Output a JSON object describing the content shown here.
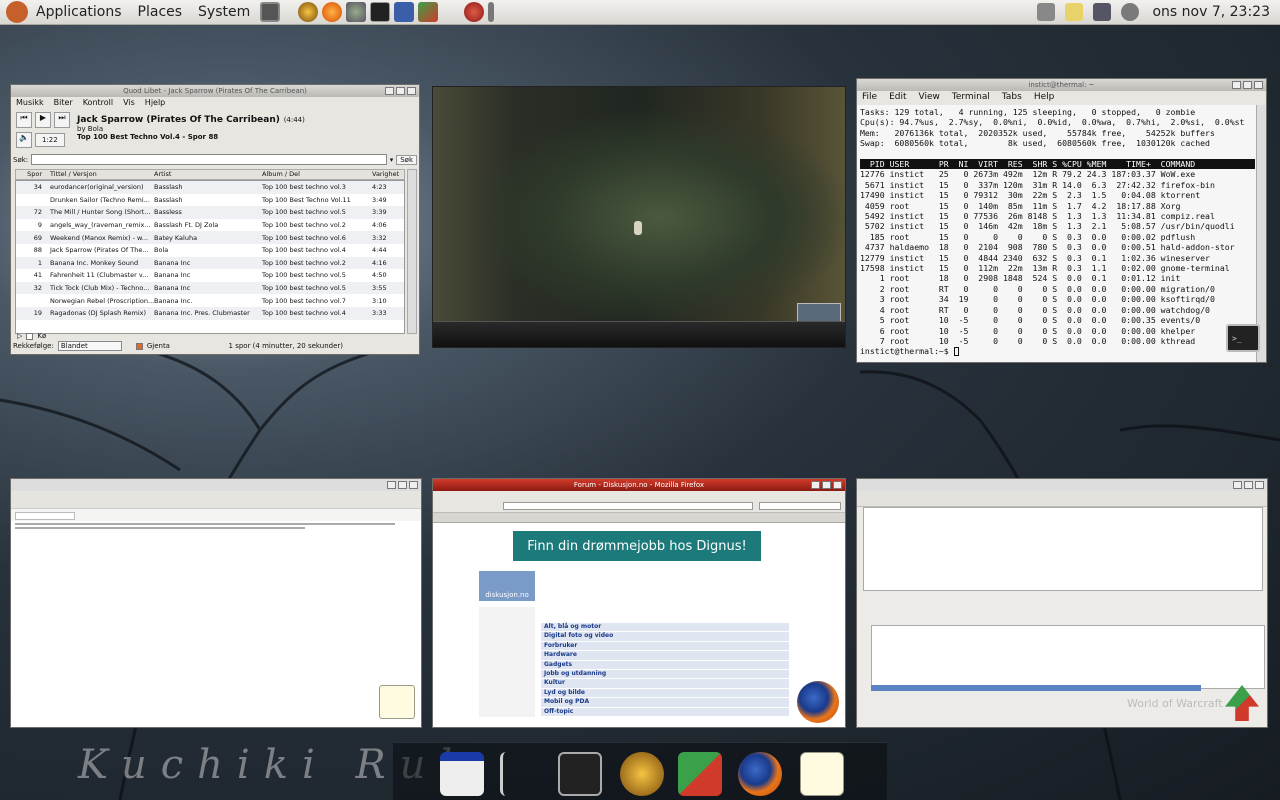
{
  "panel": {
    "menus": [
      "Applications",
      "Places",
      "System"
    ],
    "clock": "ons nov  7, 23:23"
  },
  "quodlibet": {
    "title": "Quod Libet - Jack Sparrow (Pirates Of The Carribean)",
    "menu": [
      "Musikk",
      "Biter",
      "Kontroll",
      "Vis",
      "Hjelp"
    ],
    "track_title": "Jack Sparrow (Pirates Of The Carribean)",
    "duration": "(4:44)",
    "by_line": "by Bola",
    "album_line": "Top 100 Best Techno Vol.4 - Spor 88",
    "position": "1:22",
    "search_label": "Søk:",
    "search_button": "Søk",
    "columns": [
      "Spor",
      "Tittel / Versjon",
      "Artist",
      "Album / Del",
      "Varighet"
    ],
    "rows": [
      [
        "34",
        "eurodancer(original_version)",
        "Basslash",
        "Top 100 best techno vol.3",
        "4:23"
      ],
      [
        "",
        "Drunken Sailor (Techno Remi...",
        "Basslash",
        "Top 100 Best Techno Vol.11",
        "3:49"
      ],
      [
        "72",
        "The Mill / Hunter Song (Short...",
        "Bassless",
        "Top 100 best techno vol.5",
        "3:39"
      ],
      [
        "9",
        "angels_way_(raveman_remix...",
        "Basslash Ft. DJ Zola",
        "Top 100 best techno vol.2",
        "4:06"
      ],
      [
        "69",
        "Weekend (Manox Remix) - w...",
        "Batey Kaluha",
        "Top 100 best techno vol.6",
        "3:32"
      ],
      [
        "88",
        "Jack Sparrow (Pirates Of The...",
        "Bola",
        "Top 100 best techno vol.4",
        "4:44"
      ],
      [
        "1",
        "Banana Inc. Monkey Sound",
        "Banana Inc",
        "Top 100 best techno vol.2",
        "4:16"
      ],
      [
        "41",
        "Fahrenheit 11 (Clubmaster v...",
        "Banana Inc",
        "Top 100 best techno vol.5",
        "4:50"
      ],
      [
        "32",
        "Tick Tock (Club Mix) - Techno...",
        "Banana Inc",
        "Top 100 best techno vol.5",
        "3:55"
      ],
      [
        "",
        "Norwegian Rebel (Proscription...",
        "Banana Inc.",
        "Top 100 best techno vol.7",
        "3:10"
      ],
      [
        "19",
        "Ragadonas (DJ Splash Remix)",
        "Banana Inc. Pres. Clubmaster",
        "Top 100 best techno vol.4",
        "3:33"
      ]
    ],
    "kø_label": "Kø",
    "order_label": "Rekkefølge:",
    "order_value": "Blandet",
    "repeat_label": "Gjenta",
    "status": "1 spor (4 minutter, 20 sekunder)"
  },
  "terminal": {
    "title": "instict@thermal: ~",
    "menu": [
      "File",
      "Edit",
      "View",
      "Terminal",
      "Tabs",
      "Help"
    ],
    "summary": [
      "Tasks: 129 total,   4 running, 125 sleeping,   0 stopped,   0 zombie",
      "Cpu(s): 94.7%us,  2.7%sy,  0.0%ni,  0.0%id,  0.0%wa,  0.7%hi,  2.0%si,  0.0%st",
      "Mem:   2076136k total,  2020352k used,    55784k free,    54252k buffers",
      "Swap:  6080560k total,        8k used,  6080560k free,  1030120k cached"
    ],
    "header": "  PID USER      PR  NI  VIRT  RES  SHR S %CPU %MEM    TIME+  COMMAND",
    "procs": [
      "12776 instict   25   0 2673m 492m  12m R 79.2 24.3 187:03.37 WoW.exe",
      " 5671 instict   15   0  337m 120m  31m R 14.0  6.3  27:42.32 firefox-bin",
      "17490 instict   15   0 79312  30m  22m S  2.3  1.5   0:04.08 ktorrent",
      " 4059 root      15   0  140m  85m  11m S  1.7  4.2  18:17.88 Xorg",
      " 5492 instict   15   0 77536  26m 8148 S  1.3  1.3  11:34.81 compiz.real",
      " 5702 instict   15   0  146m  42m  18m S  1.3  2.1   5:08.57 /usr/bin/quodli",
      "  185 root      15   0     0    0    0 S  0.3  0.0   0:00.02 pdflush",
      " 4737 haldaemo  18   0  2104  908  780 S  0.3  0.0   0:00.51 hald-addon-stor",
      "12779 instict   15   0  4844 2340  632 S  0.3  0.1   1:02.36 wineserver",
      "17598 instict   15   0  112m  22m  13m R  0.3  1.1   0:02.00 gnome-terminal",
      "    1 root      18   0  2908 1848  524 S  0.0  0.1   0:01.12 init",
      "    2 root      RT   0     0    0    0 S  0.0  0.0   0:00.00 migration/0",
      "    3 root      34  19     0    0    0 S  0.0  0.0   0:00.00 ksoftirqd/0",
      "    4 root      RT   0     0    0    0 S  0.0  0.0   0:00.00 watchdog/0",
      "    5 root      10  -5     0    0    0 S  0.0  0.0   0:00.35 events/0",
      "    6 root      10  -5     0    0    0 S  0.0  0.0   0:00.00 khelper",
      "    7 root      10  -5     0    0    0 S  0.0  0.0   0:00.00 kthread"
    ],
    "prompt": "instict@thermal:~$ "
  },
  "firefox": {
    "title": "Forum - Diskusjon.no - Mozilla Firefox",
    "banner": "Finn din drømmejobb hos Dignus!",
    "site_name": "diskusjon.no",
    "forum_links": [
      "Alt, blå og motor",
      "Digital foto og video",
      "Forbruker",
      "Hardware",
      "Gadgets",
      "Jobb og utdanning",
      "Kultur",
      "Lyd og bilde",
      "Mobil og PDA",
      "Off-topic"
    ]
  },
  "ktorrent": {
    "brand": "World of Warcraft"
  },
  "dock": {
    "wallpaper_text": "Kuchiki Ruk"
  }
}
